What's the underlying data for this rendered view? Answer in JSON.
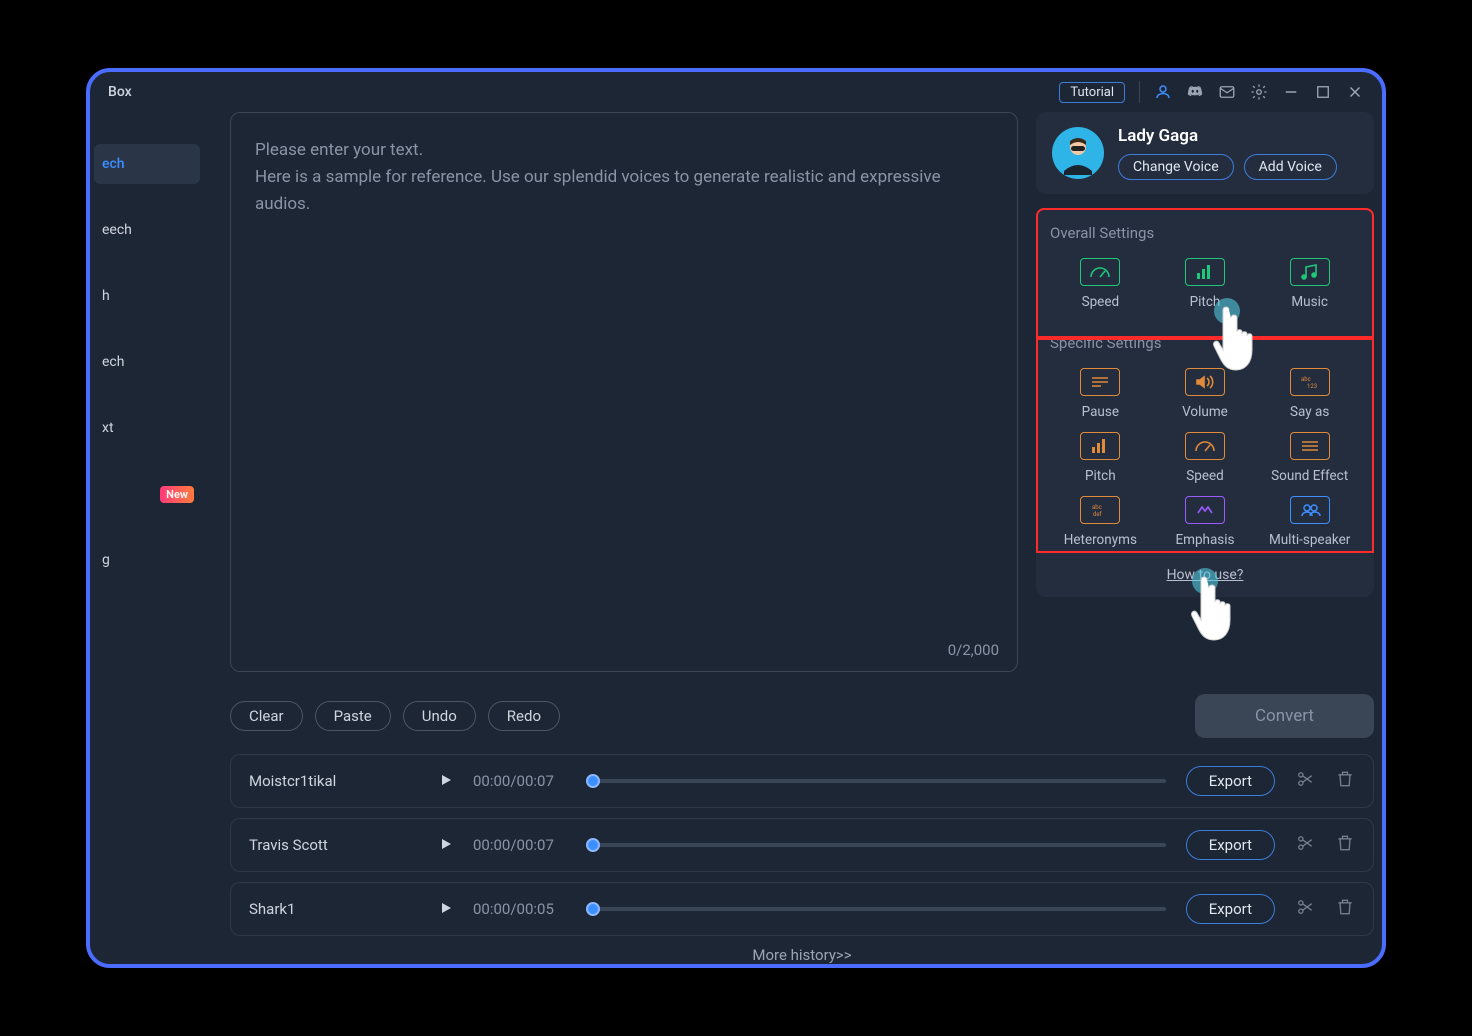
{
  "titlebar": {
    "app_name": "Box",
    "tutorial": "Tutorial"
  },
  "sidebar": {
    "items": [
      {
        "label": "ech"
      },
      {
        "label": "eech"
      },
      {
        "label": "h"
      },
      {
        "label": "ech"
      },
      {
        "label": "xt"
      },
      {
        "label": "",
        "badge": "New"
      },
      {
        "label": "g"
      }
    ]
  },
  "editor": {
    "placeholder_line1": "Please enter your text.",
    "placeholder_line2": "Here is a sample for reference. Use our splendid voices to generate realistic and expressive audios.",
    "char_count": "0/2,000"
  },
  "voice": {
    "name": "Lady Gaga",
    "change_label": "Change Voice",
    "add_label": "Add Voice"
  },
  "overall": {
    "title": "Overall Settings",
    "items": [
      "Speed",
      "Pitch",
      "Music"
    ]
  },
  "specific": {
    "title": "Specific Settings",
    "items": [
      "Pause",
      "Volume",
      "Say as",
      "Pitch",
      "Speed",
      "Sound Effect",
      "Heteronyms",
      "Emphasis",
      "Multi-speaker"
    ]
  },
  "how_to_use": "How to use?",
  "actions": {
    "clear": "Clear",
    "paste": "Paste",
    "undo": "Undo",
    "redo": "Redo",
    "convert": "Convert"
  },
  "history": {
    "tracks": [
      {
        "name": "Moistcr1tikal",
        "time": "00:00/00:07"
      },
      {
        "name": "Travis Scott",
        "time": "00:00/00:07"
      },
      {
        "name": "Shark1",
        "time": "00:00/00:05"
      }
    ],
    "export_label": "Export",
    "more_label": "More history>>"
  }
}
